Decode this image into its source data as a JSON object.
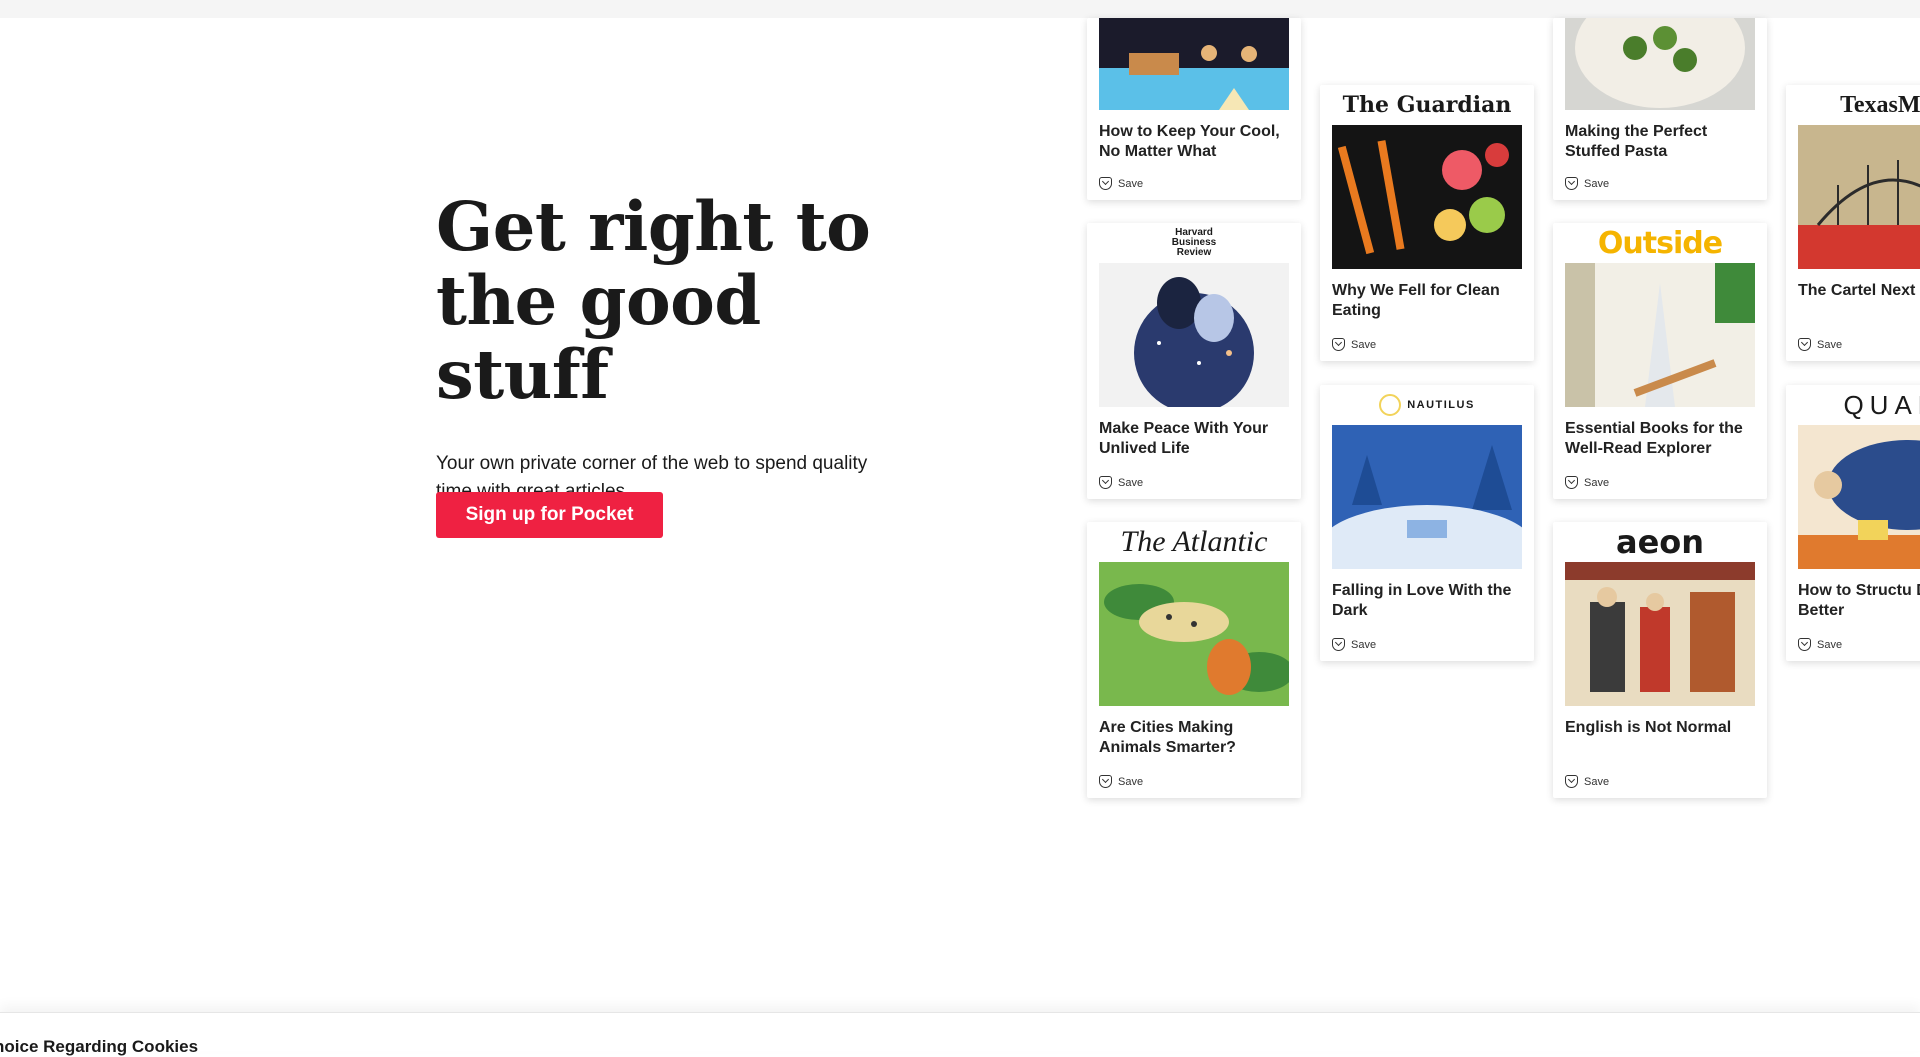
{
  "hero": {
    "heading_line1": "Get right to",
    "heading_line2": "the good stuff",
    "subtitle": "Your own private corner of the web to spend quality time with great articles.",
    "cta_label": "Sign up for Pocket"
  },
  "cards": {
    "save_label": "Save",
    "keep_cool": {
      "title": "How to Keep Your Cool, No Matter What"
    },
    "peace": {
      "publisher": "Harvard Business Review",
      "title": "Make Peace With Your Unlived Life"
    },
    "cities": {
      "publisher": "The Atlantic",
      "title": "Are Cities Making Animals Smarter?"
    },
    "clean_eating": {
      "publisher": "The Guardian",
      "title": "Why We Fell for Clean Eating"
    },
    "dark": {
      "publisher": "NAUTILUS",
      "title": "Falling in Love With the Dark"
    },
    "pasta": {
      "title": "Making the Perfect Stuffed Pasta"
    },
    "books": {
      "publisher": "Outside",
      "title": "Essential Books for the Well-Read Explorer"
    },
    "english": {
      "publisher": "aeon",
      "title": "English is Not Normal"
    },
    "cartel": {
      "publisher": "TexasMon",
      "title": "The Cartel Next"
    },
    "structure": {
      "publisher": "QUAR",
      "title": "How to Structu Day Better"
    }
  },
  "cookie_bar": {
    "text": "hoice Regarding Cookies"
  }
}
